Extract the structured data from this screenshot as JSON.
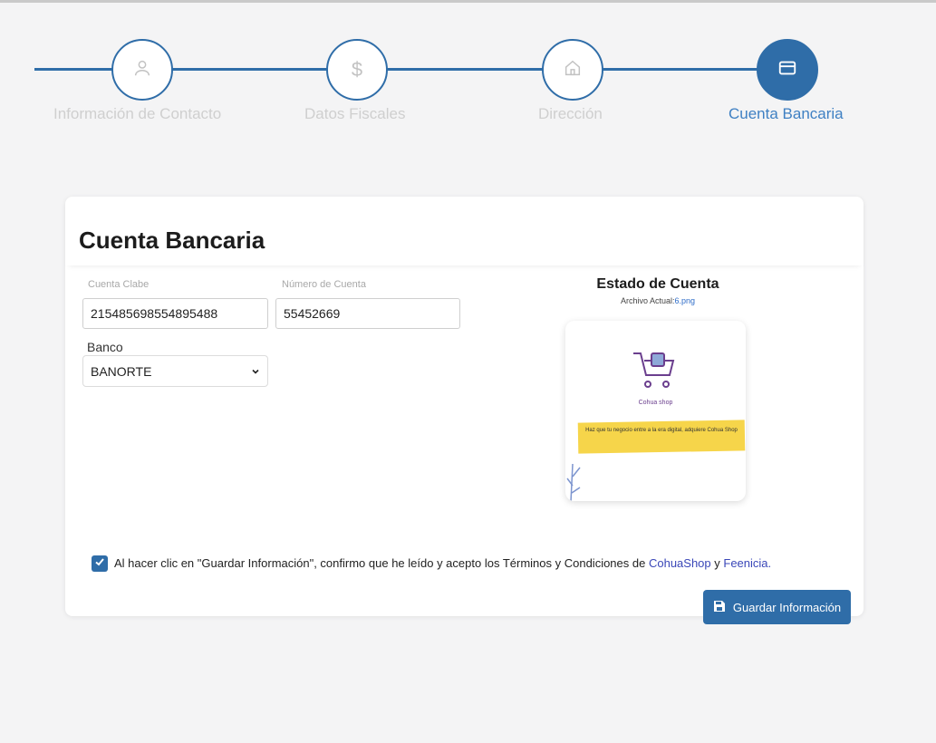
{
  "stepper": {
    "steps": [
      {
        "label": "Información de Contacto",
        "icon": "user-icon",
        "active": false
      },
      {
        "label": "Datos Fiscales",
        "icon": "dollar-icon",
        "active": false
      },
      {
        "label": "Dirección",
        "icon": "home-icon",
        "active": false
      },
      {
        "label": "Cuenta Bancaria",
        "icon": "credit-card-icon",
        "active": true
      }
    ],
    "accent": "#2f6da8",
    "inactive_label_color": "#cfcfcf"
  },
  "card": {
    "title": "Cuenta Bancaria",
    "fields": {
      "clabe_label": "Cuenta Clabe",
      "clabe_value": "215485698554895488",
      "cuenta_label": "Número de Cuenta",
      "cuenta_value": "55452669",
      "banco_label": "Banco",
      "banco_value": "BANORTE"
    },
    "statement": {
      "title": "Estado de Cuenta",
      "current_file_label": "Archivo Actual:",
      "current_file_name": "6.png",
      "preview_brand": "Cohua shop",
      "preview_banner": "Haz que tu negocio entre a la era digital, adquiere Cohua Shop"
    },
    "terms": {
      "checked": true,
      "text": "Al hacer clic en \"Guardar Información\", confirmo que he leído y acepto los Términos y Condiciones de",
      "link1": "CohuaShop",
      "conj": "y",
      "link2": "Feenicia."
    }
  },
  "save_button": {
    "label": "Guardar Información",
    "icon": "save-icon"
  }
}
